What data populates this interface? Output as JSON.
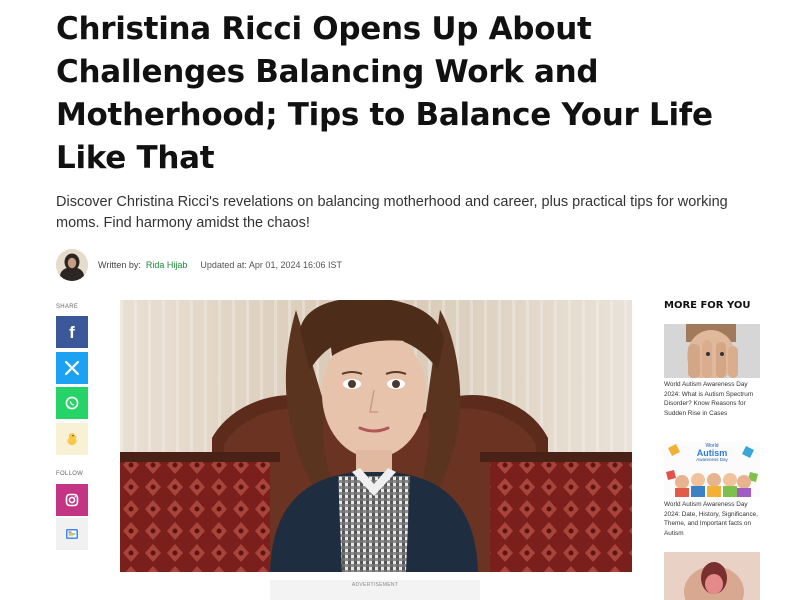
{
  "article": {
    "headline": "Christina Ricci Opens Up About Challenges Balancing Work and Motherhood; Tips to Balance Your Life Like That",
    "subhead": "Discover Christina Ricci's revelations on balancing motherhood and career, plus practical tips for working moms. Find harmony amidst the chaos!",
    "written_by_label": "Written by:",
    "author": "Rida Hijab",
    "updated": "Updated at: Apr 01, 2024 16:06 IST"
  },
  "share": {
    "label": "SHARE",
    "buttons": [
      {
        "icon": "facebook-icon",
        "color": "#3b5998"
      },
      {
        "icon": "x-icon",
        "color": "#1da1f2"
      },
      {
        "icon": "whatsapp-icon",
        "color": "#25d366"
      },
      {
        "icon": "koo-icon",
        "color": "#f8f1d6"
      }
    ]
  },
  "follow": {
    "label": "FOLLOW",
    "buttons": [
      {
        "icon": "instagram-icon",
        "color": "#c13584"
      },
      {
        "icon": "google-news-icon",
        "color": "#f1f1f1"
      }
    ]
  },
  "advertisement": {
    "label": "ADVERTISEMENT"
  },
  "more_for_you": {
    "title": "MORE FOR YOU",
    "items": [
      {
        "caption": "World Autism Awareness Day 2024: What is Autism Spectrum Disorder? Know Reasons for Sudden Rise in Cases"
      },
      {
        "caption": "World Autism Awareness Day 2024: Date, History, Significance, Theme, and Important facts on Autism",
        "badge_line1": "World",
        "badge_line2": "Autism",
        "badge_line3": "Awareness Day"
      },
      {
        "caption": ""
      }
    ]
  }
}
